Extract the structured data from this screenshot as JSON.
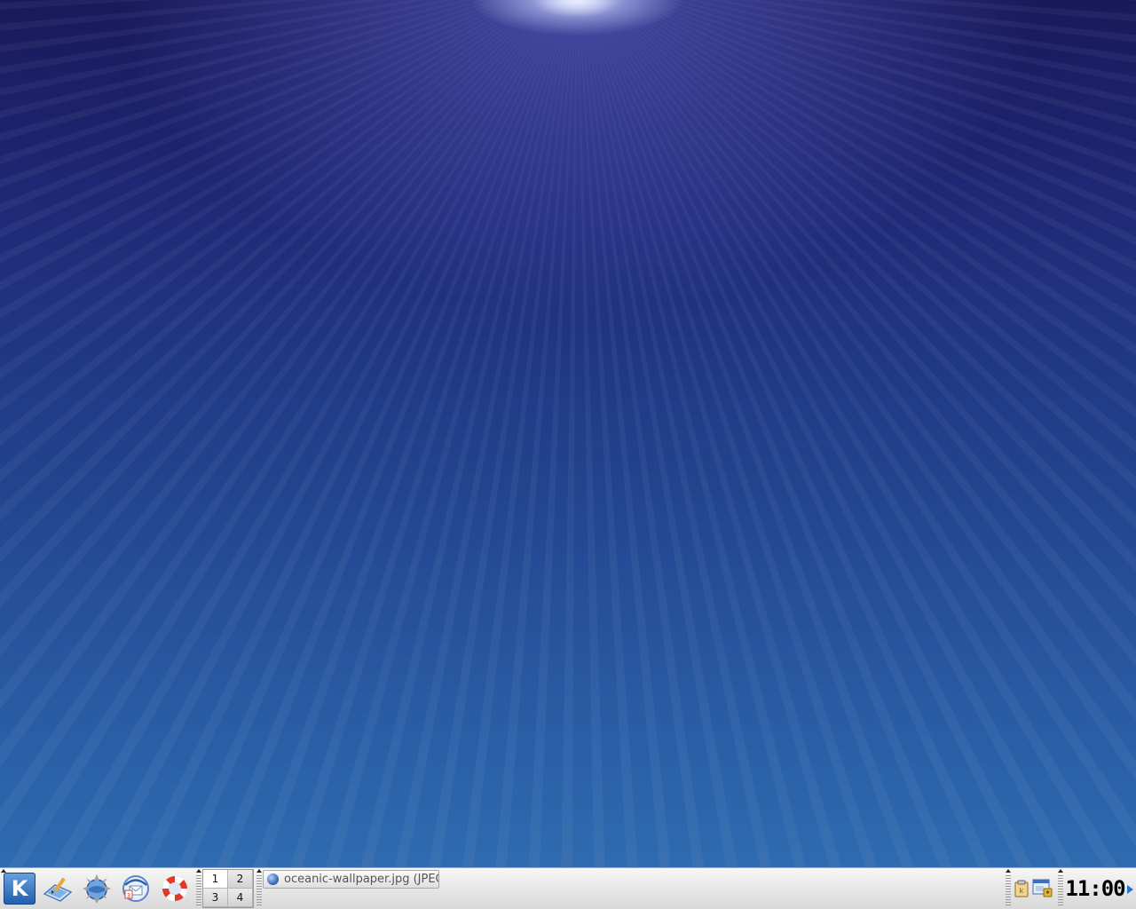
{
  "desktop": {
    "wallpaper": "oceanic light rays",
    "colors": {
      "top": "#19195a",
      "bottom": "#2f6bb0",
      "glow": "#d6dcff"
    }
  },
  "panel": {
    "launchers": [
      {
        "name": "kmenu",
        "label": "K",
        "icon": "kde-k-icon"
      },
      {
        "name": "desktop",
        "icon": "show-desktop-icon"
      },
      {
        "name": "konqueror",
        "icon": "konqueror-icon"
      },
      {
        "name": "kontact",
        "icon": "kontact-icon"
      },
      {
        "name": "help",
        "icon": "help-lifebuoy-icon"
      }
    ],
    "pager": {
      "desktops": [
        "1",
        "2",
        "3",
        "4"
      ],
      "active": "1"
    },
    "taskbar": {
      "tasks": [
        {
          "label": "oceanic-wallpaper.jpg (JPEG",
          "icon": "konqueror-globe-icon"
        }
      ]
    },
    "tray": [
      {
        "name": "klipper",
        "icon": "clipboard-icon"
      },
      {
        "name": "kwallet",
        "icon": "wallet-icon"
      }
    ],
    "clock": {
      "time": "11:00"
    }
  }
}
